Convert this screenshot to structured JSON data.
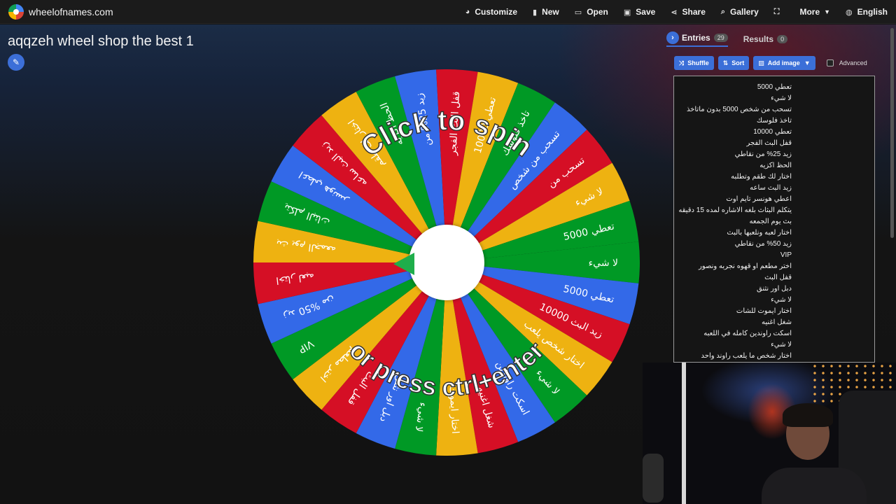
{
  "brand": {
    "name": "wheelofnames.com",
    "icon": "wheel-logo-icon"
  },
  "nav": [
    {
      "label": "Customize",
      "icon": "palette-icon",
      "glyph": "🎨"
    },
    {
      "label": "New",
      "icon": "file-icon",
      "glyph": "▮"
    },
    {
      "label": "Open",
      "icon": "folder-icon",
      "glyph": "▭"
    },
    {
      "label": "Save",
      "icon": "save-icon",
      "glyph": "▣"
    },
    {
      "label": "Share",
      "icon": "share-icon",
      "glyph": "⋖"
    },
    {
      "label": "Gallery",
      "icon": "search-icon",
      "glyph": "⌕"
    },
    {
      "label": "",
      "icon": "fullscreen-icon",
      "glyph": "⛶"
    },
    {
      "label": "More",
      "icon": "caret-down-icon",
      "glyph": ""
    },
    {
      "label": "English",
      "icon": "globe-icon",
      "glyph": "◍"
    }
  ],
  "page": {
    "title": "aqqzeh wheel shop the best 1"
  },
  "wheel": {
    "spin_line1": "Click to spin",
    "spin_line2": "or press ctrl+enter",
    "colors": [
      "#3369e8",
      "#d50f25",
      "#eeb211",
      "#009925"
    ]
  },
  "panel": {
    "tab_entries": "Entries",
    "entries_count": "29",
    "tab_results": "Results",
    "results_count": "0",
    "shuffle": "Shuffle",
    "sort": "Sort",
    "add_image": "Add image",
    "advanced": "Advanced"
  },
  "entries": [
    "تعطي 5000",
    "لا شيء",
    "تسحب من شخص 5000 بدون ماتاخذ",
    "تاخذ فلوسك",
    "تعطي 10000",
    "قفل البث الفجر",
    "زيد 25% من نقاطي",
    "الحظ اكزيه",
    "اختار لك طقم وتطلبه",
    "زيد البث ساعه",
    "اعطي هونسر تايم اوت",
    "يتكلم البثاث بلغه الاشاره لمده 15 دقيقه",
    "بث يوم الجمعه",
    "اختار لعبه ونلعبها بالبث",
    "زيد 50% من نقاطي",
    "VIP",
    "اختر مطعم او قهوه نجربه ونصور",
    "قفل البث",
    "دبل اور نثنق",
    "لا شيء",
    "اختار ايموت للشات",
    "شغل اغنيه",
    "اسكت راوندين كامله في اللعبه",
    "لا شيء",
    "اختار شخص ما يلعب راوند واحد"
  ],
  "slice_labels": [
    "لا شيء",
    "تعطي 5000",
    "زيد البث 10000",
    "اختار شخص يلعب",
    "لا شيء",
    "اسكت راوندين",
    "شغل اغنيه",
    "اختار ايموت",
    "لا شيء",
    "دبل اور نثنق",
    "قفل البث",
    "اختر مطعم",
    "VIP",
    "زيد 50% من",
    "اختار لعبه",
    "بث يوم الجمعه",
    "يتكلم البثاث",
    "اعطي هونسر",
    "زيد البث ساعه",
    "اختار لك طقم",
    "الحظ اكزيه",
    "زيد 25% من",
    "قفل البث الفجر",
    "تعطي 10000",
    "تاخذ فلوسك",
    "تسحب من شخص",
    "تسحب من",
    "لا شيء",
    "تعطي 5000"
  ]
}
